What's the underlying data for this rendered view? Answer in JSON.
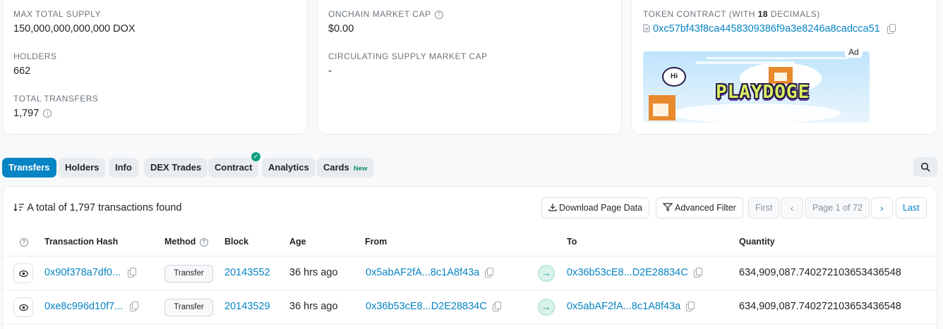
{
  "overview": {
    "max_supply_label": "MAX TOTAL SUPPLY",
    "max_supply_value": "150,000,000,000,000 DOX",
    "holders_label": "HOLDERS",
    "holders_value": "662",
    "transfers_label": "TOTAL TRANSFERS",
    "transfers_value": "1,797"
  },
  "market": {
    "onchain_cap_label": "ONCHAIN MARKET CAP",
    "onchain_cap_value": "$0.00",
    "circ_cap_label": "CIRCULATING SUPPLY MARKET CAP",
    "circ_cap_value": "-"
  },
  "other_info": {
    "contract_label_prefix": "TOKEN CONTRACT (WITH ",
    "decimals": "18",
    "contract_label_suffix": " DECIMALS)",
    "contract_address": "0xc57bf43f8ca4458309386f9a3e8246a8cadcca51",
    "ad_badge": "Ad",
    "ad_title": "PLAYDOGE",
    "ad_bubble": "Hi"
  },
  "tabs": [
    {
      "label": "Transfers",
      "active": true
    },
    {
      "label": "Holders"
    },
    {
      "label": "Info"
    },
    {
      "label": "DEX Trades"
    },
    {
      "label": "Contract",
      "verified": true
    },
    {
      "label": "Analytics"
    },
    {
      "label": "Cards",
      "badge": "New"
    }
  ],
  "table_header": {
    "summary": "A total of 1,797 transactions found",
    "download": "Download Page Data",
    "filter": "Advanced Filter",
    "first": "First",
    "page": "Page 1 of 72",
    "last": "Last"
  },
  "columns": {
    "hash": "Transaction Hash",
    "method": "Method",
    "block": "Block",
    "age": "Age",
    "from": "From",
    "to": "To",
    "quantity": "Quantity"
  },
  "rows": [
    {
      "hash": "0x90f378a7df0...",
      "method": "Transfer",
      "block": "20143552",
      "age": "36 hrs ago",
      "from": "0x5abAF2fA...8c1A8f43a",
      "to": "0x36b53cE8...D2E28834C",
      "quantity": "634,909,087.740272103653436548"
    },
    {
      "hash": "0xe8c996d10f7...",
      "method": "Transfer",
      "block": "20143529",
      "age": "36 hrs ago",
      "from": "0x36b53cE8...D2E28834C",
      "to": "0x5abAF2fA...8c1A8f43a",
      "quantity": "634,909,087.740272103653436548"
    }
  ],
  "colors": {
    "accent": "#0784c3",
    "success": "#0e9f83"
  }
}
